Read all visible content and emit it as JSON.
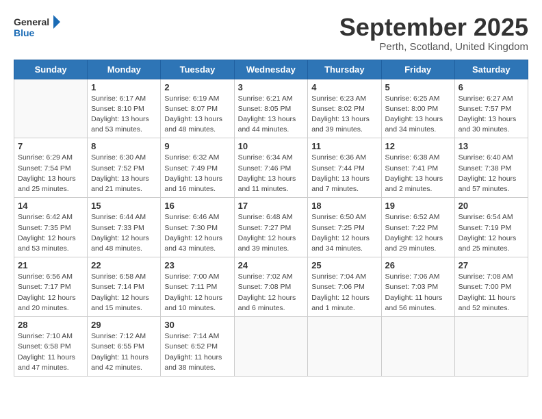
{
  "header": {
    "logo_general": "General",
    "logo_blue": "Blue",
    "month_title": "September 2025",
    "location": "Perth, Scotland, United Kingdom"
  },
  "days_of_week": [
    "Sunday",
    "Monday",
    "Tuesday",
    "Wednesday",
    "Thursday",
    "Friday",
    "Saturday"
  ],
  "weeks": [
    [
      {
        "day": "",
        "empty": true
      },
      {
        "day": "1",
        "sunrise": "Sunrise: 6:17 AM",
        "sunset": "Sunset: 8:10 PM",
        "daylight": "Daylight: 13 hours and 53 minutes."
      },
      {
        "day": "2",
        "sunrise": "Sunrise: 6:19 AM",
        "sunset": "Sunset: 8:07 PM",
        "daylight": "Daylight: 13 hours and 48 minutes."
      },
      {
        "day": "3",
        "sunrise": "Sunrise: 6:21 AM",
        "sunset": "Sunset: 8:05 PM",
        "daylight": "Daylight: 13 hours and 44 minutes."
      },
      {
        "day": "4",
        "sunrise": "Sunrise: 6:23 AM",
        "sunset": "Sunset: 8:02 PM",
        "daylight": "Daylight: 13 hours and 39 minutes."
      },
      {
        "day": "5",
        "sunrise": "Sunrise: 6:25 AM",
        "sunset": "Sunset: 8:00 PM",
        "daylight": "Daylight: 13 hours and 34 minutes."
      },
      {
        "day": "6",
        "sunrise": "Sunrise: 6:27 AM",
        "sunset": "Sunset: 7:57 PM",
        "daylight": "Daylight: 13 hours and 30 minutes."
      }
    ],
    [
      {
        "day": "7",
        "sunrise": "Sunrise: 6:29 AM",
        "sunset": "Sunset: 7:54 PM",
        "daylight": "Daylight: 13 hours and 25 minutes."
      },
      {
        "day": "8",
        "sunrise": "Sunrise: 6:30 AM",
        "sunset": "Sunset: 7:52 PM",
        "daylight": "Daylight: 13 hours and 21 minutes."
      },
      {
        "day": "9",
        "sunrise": "Sunrise: 6:32 AM",
        "sunset": "Sunset: 7:49 PM",
        "daylight": "Daylight: 13 hours and 16 minutes."
      },
      {
        "day": "10",
        "sunrise": "Sunrise: 6:34 AM",
        "sunset": "Sunset: 7:46 PM",
        "daylight": "Daylight: 13 hours and 11 minutes."
      },
      {
        "day": "11",
        "sunrise": "Sunrise: 6:36 AM",
        "sunset": "Sunset: 7:44 PM",
        "daylight": "Daylight: 13 hours and 7 minutes."
      },
      {
        "day": "12",
        "sunrise": "Sunrise: 6:38 AM",
        "sunset": "Sunset: 7:41 PM",
        "daylight": "Daylight: 13 hours and 2 minutes."
      },
      {
        "day": "13",
        "sunrise": "Sunrise: 6:40 AM",
        "sunset": "Sunset: 7:38 PM",
        "daylight": "Daylight: 12 hours and 57 minutes."
      }
    ],
    [
      {
        "day": "14",
        "sunrise": "Sunrise: 6:42 AM",
        "sunset": "Sunset: 7:35 PM",
        "daylight": "Daylight: 12 hours and 53 minutes."
      },
      {
        "day": "15",
        "sunrise": "Sunrise: 6:44 AM",
        "sunset": "Sunset: 7:33 PM",
        "daylight": "Daylight: 12 hours and 48 minutes."
      },
      {
        "day": "16",
        "sunrise": "Sunrise: 6:46 AM",
        "sunset": "Sunset: 7:30 PM",
        "daylight": "Daylight: 12 hours and 43 minutes."
      },
      {
        "day": "17",
        "sunrise": "Sunrise: 6:48 AM",
        "sunset": "Sunset: 7:27 PM",
        "daylight": "Daylight: 12 hours and 39 minutes."
      },
      {
        "day": "18",
        "sunrise": "Sunrise: 6:50 AM",
        "sunset": "Sunset: 7:25 PM",
        "daylight": "Daylight: 12 hours and 34 minutes."
      },
      {
        "day": "19",
        "sunrise": "Sunrise: 6:52 AM",
        "sunset": "Sunset: 7:22 PM",
        "daylight": "Daylight: 12 hours and 29 minutes."
      },
      {
        "day": "20",
        "sunrise": "Sunrise: 6:54 AM",
        "sunset": "Sunset: 7:19 PM",
        "daylight": "Daylight: 12 hours and 25 minutes."
      }
    ],
    [
      {
        "day": "21",
        "sunrise": "Sunrise: 6:56 AM",
        "sunset": "Sunset: 7:17 PM",
        "daylight": "Daylight: 12 hours and 20 minutes."
      },
      {
        "day": "22",
        "sunrise": "Sunrise: 6:58 AM",
        "sunset": "Sunset: 7:14 PM",
        "daylight": "Daylight: 12 hours and 15 minutes."
      },
      {
        "day": "23",
        "sunrise": "Sunrise: 7:00 AM",
        "sunset": "Sunset: 7:11 PM",
        "daylight": "Daylight: 12 hours and 10 minutes."
      },
      {
        "day": "24",
        "sunrise": "Sunrise: 7:02 AM",
        "sunset": "Sunset: 7:08 PM",
        "daylight": "Daylight: 12 hours and 6 minutes."
      },
      {
        "day": "25",
        "sunrise": "Sunrise: 7:04 AM",
        "sunset": "Sunset: 7:06 PM",
        "daylight": "Daylight: 12 hours and 1 minute."
      },
      {
        "day": "26",
        "sunrise": "Sunrise: 7:06 AM",
        "sunset": "Sunset: 7:03 PM",
        "daylight": "Daylight: 11 hours and 56 minutes."
      },
      {
        "day": "27",
        "sunrise": "Sunrise: 7:08 AM",
        "sunset": "Sunset: 7:00 PM",
        "daylight": "Daylight: 11 hours and 52 minutes."
      }
    ],
    [
      {
        "day": "28",
        "sunrise": "Sunrise: 7:10 AM",
        "sunset": "Sunset: 6:58 PM",
        "daylight": "Daylight: 11 hours and 47 minutes."
      },
      {
        "day": "29",
        "sunrise": "Sunrise: 7:12 AM",
        "sunset": "Sunset: 6:55 PM",
        "daylight": "Daylight: 11 hours and 42 minutes."
      },
      {
        "day": "30",
        "sunrise": "Sunrise: 7:14 AM",
        "sunset": "Sunset: 6:52 PM",
        "daylight": "Daylight: 11 hours and 38 minutes."
      },
      {
        "day": "",
        "empty": true
      },
      {
        "day": "",
        "empty": true
      },
      {
        "day": "",
        "empty": true
      },
      {
        "day": "",
        "empty": true
      }
    ]
  ]
}
